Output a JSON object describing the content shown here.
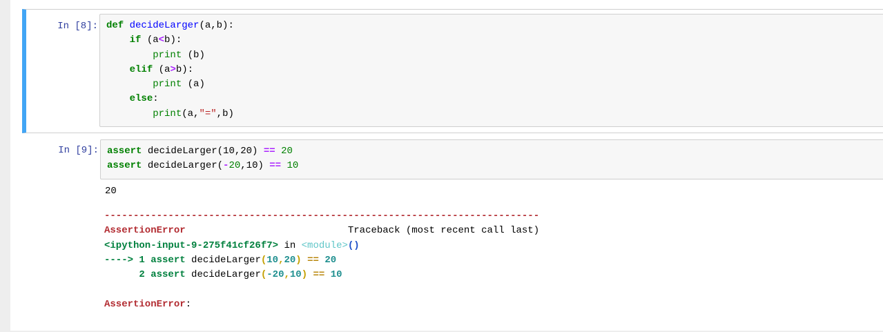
{
  "cells": [
    {
      "prompt": "In [8]:",
      "code": [
        [
          [
            "kw",
            "def"
          ],
          [
            "txt",
            " "
          ],
          [
            "fn",
            "decideLarger"
          ],
          [
            "txt",
            "(a,b):"
          ]
        ],
        [
          [
            "txt",
            "    "
          ],
          [
            "kw",
            "if"
          ],
          [
            "txt",
            " (a"
          ],
          [
            "op",
            "<"
          ],
          [
            "txt",
            "b):"
          ]
        ],
        [
          [
            "txt",
            "        "
          ],
          [
            "bi",
            "print"
          ],
          [
            "txt",
            " (b)"
          ]
        ],
        [
          [
            "txt",
            "    "
          ],
          [
            "kw",
            "elif"
          ],
          [
            "txt",
            " (a"
          ],
          [
            "op",
            ">"
          ],
          [
            "txt",
            "b):"
          ]
        ],
        [
          [
            "txt",
            "        "
          ],
          [
            "bi",
            "print"
          ],
          [
            "txt",
            " (a)"
          ]
        ],
        [
          [
            "txt",
            "    "
          ],
          [
            "kw",
            "else"
          ],
          [
            "txt",
            ":"
          ]
        ],
        [
          [
            "txt",
            "        "
          ],
          [
            "bi",
            "print"
          ],
          [
            "txt",
            "(a,"
          ],
          [
            "str",
            "\"=\""
          ],
          [
            "txt",
            ",b)"
          ]
        ]
      ]
    },
    {
      "prompt": "In [9]:",
      "code": [
        [
          [
            "kw",
            "assert"
          ],
          [
            "txt",
            " decideLarger(10,20) "
          ],
          [
            "op",
            "=="
          ],
          [
            "txt",
            " "
          ],
          [
            "num",
            "20"
          ]
        ],
        [
          [
            "kw",
            "assert"
          ],
          [
            "txt",
            " decideLarger("
          ],
          [
            "op",
            "-"
          ],
          [
            "num",
            "20"
          ],
          [
            "txt",
            ",10) "
          ],
          [
            "op",
            "=="
          ],
          [
            "txt",
            " "
          ],
          [
            "num",
            "10"
          ]
        ]
      ],
      "output": {
        "stdout": "20",
        "traceback": [
          [
            [
              "tb-red",
              "---------------------------------------------------------------------------"
            ]
          ],
          [
            [
              "tb-red",
              "AssertionError"
            ],
            [
              "txt",
              "                            Traceback (most recent call last)"
            ]
          ],
          [
            [
              "tb-green",
              "<ipython-input-9-275f41cf26f7>"
            ],
            [
              "txt",
              " in "
            ],
            [
              "tb-cyan",
              "<module>"
            ],
            [
              "tb-blue",
              "()"
            ]
          ],
          [
            [
              "tb-green",
              "----> 1 "
            ],
            [
              "tb-green",
              "assert"
            ],
            [
              "txt",
              " decideLarger"
            ],
            [
              "tb-brown",
              "("
            ],
            [
              "tb-teal",
              "10"
            ],
            [
              "tb-brown",
              ","
            ],
            [
              "tb-teal",
              "20"
            ],
            [
              "tb-brown",
              ")"
            ],
            [
              "txt",
              " "
            ],
            [
              "tb-eq",
              "=="
            ],
            [
              "txt",
              " "
            ],
            [
              "tb-teal",
              "20"
            ]
          ],
          [
            [
              "tb-green",
              "      2 "
            ],
            [
              "tb-green",
              "assert"
            ],
            [
              "txt",
              " decideLarger"
            ],
            [
              "tb-brown",
              "("
            ],
            [
              "tb-teal",
              "-20"
            ],
            [
              "tb-brown",
              ","
            ],
            [
              "tb-teal",
              "10"
            ],
            [
              "tb-brown",
              ")"
            ],
            [
              "txt",
              " "
            ],
            [
              "tb-eq",
              "=="
            ],
            [
              "txt",
              " "
            ],
            [
              "tb-teal",
              "10"
            ]
          ],
          [
            [
              "txt",
              ""
            ]
          ],
          [
            [
              "tb-red",
              "AssertionError"
            ],
            [
              "txt",
              ":"
            ]
          ]
        ]
      }
    }
  ]
}
